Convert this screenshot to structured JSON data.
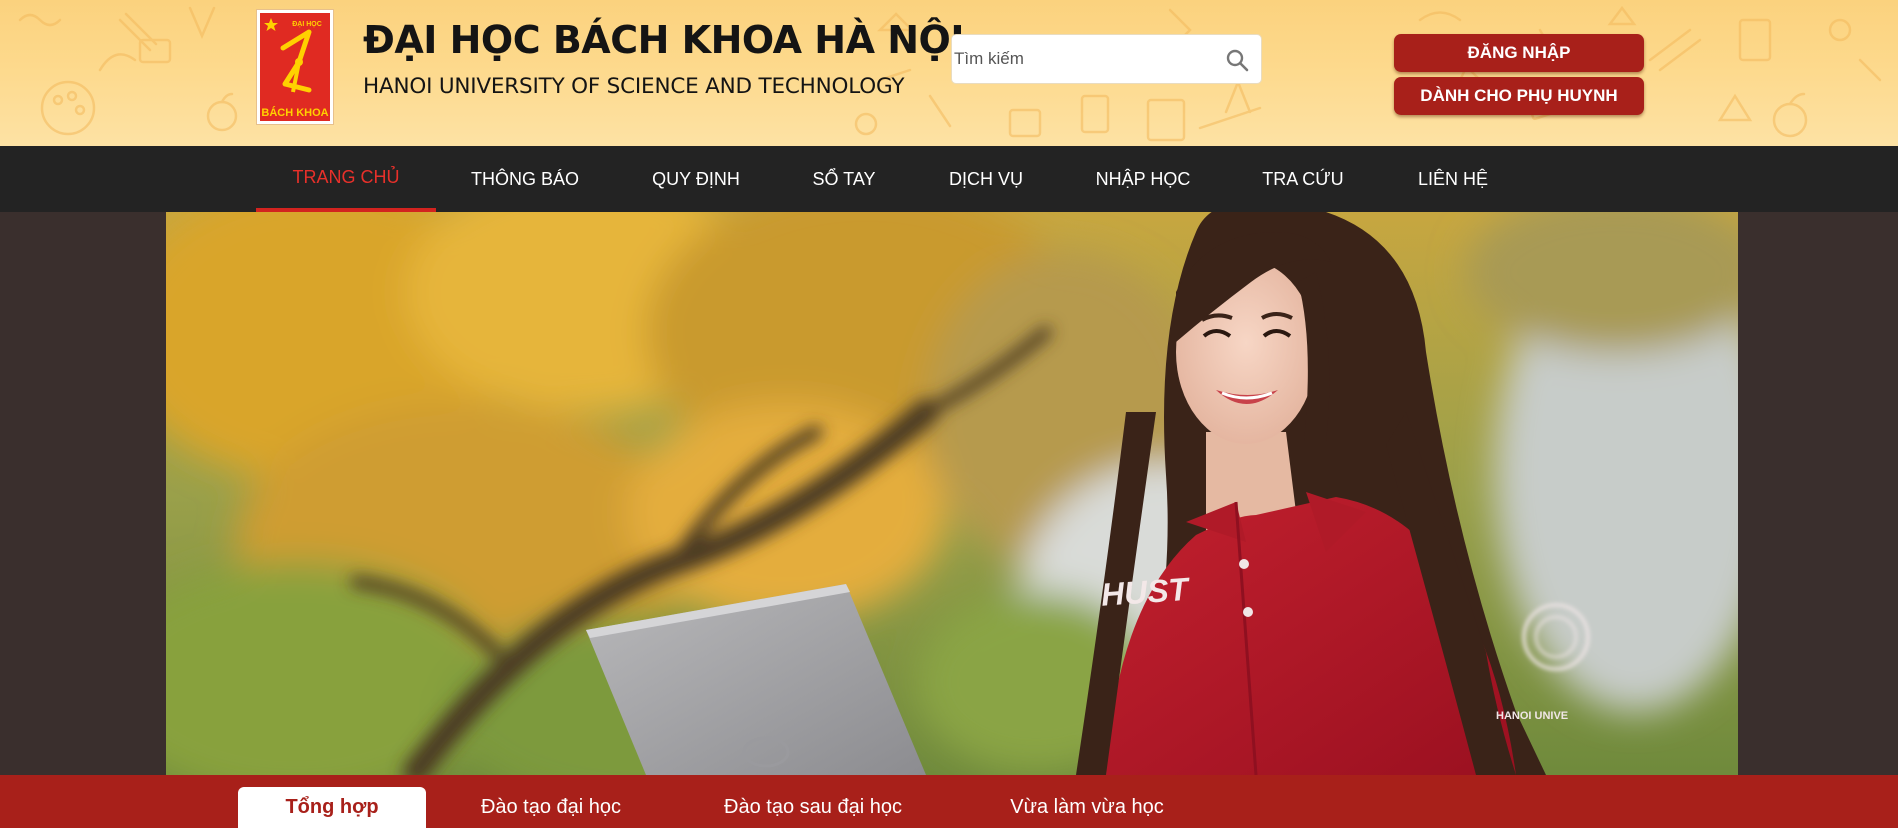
{
  "header": {
    "logo": {
      "top_text": "ĐẠI HỌC",
      "bottom_text": "BÁCH KHOA",
      "icon": "hust-logo-icon"
    },
    "title": "ĐẠI HỌC BÁCH KHOA HÀ NỘI",
    "subtitle": "HANOI UNIVERSITY OF SCIENCE AND TECHNOLOGY",
    "search": {
      "placeholder": "Tìm kiếm",
      "icon": "search-icon"
    },
    "login_label": "ĐĂNG NHẬP",
    "parents_label": "DÀNH CHO PHỤ HUYNH"
  },
  "nav": {
    "items": [
      {
        "label": "TRANG CHỦ",
        "active": true
      },
      {
        "label": "THÔNG BÁO"
      },
      {
        "label": "QUY ĐỊNH"
      },
      {
        "label": "SỔ TAY"
      },
      {
        "label": "DỊCH VỤ"
      },
      {
        "label": "NHẬP HỌC"
      },
      {
        "label": "TRA CỨU"
      },
      {
        "label": "LIÊN HỆ"
      }
    ]
  },
  "hero": {
    "shirt_text": "HUST",
    "sleeve_text": "HANOI UNIVE"
  },
  "tabs": {
    "items": [
      {
        "label": "Tổng hợp",
        "active": true
      },
      {
        "label": "Đào tạo đại học"
      },
      {
        "label": "Đào tạo sau đại học"
      },
      {
        "label": "Vừa làm vừa học"
      }
    ]
  },
  "colors": {
    "brand_red": "#a8201a",
    "nav_bg": "#232323",
    "nav_active": "#e8302a",
    "header_yellow": "#fdd98c"
  }
}
